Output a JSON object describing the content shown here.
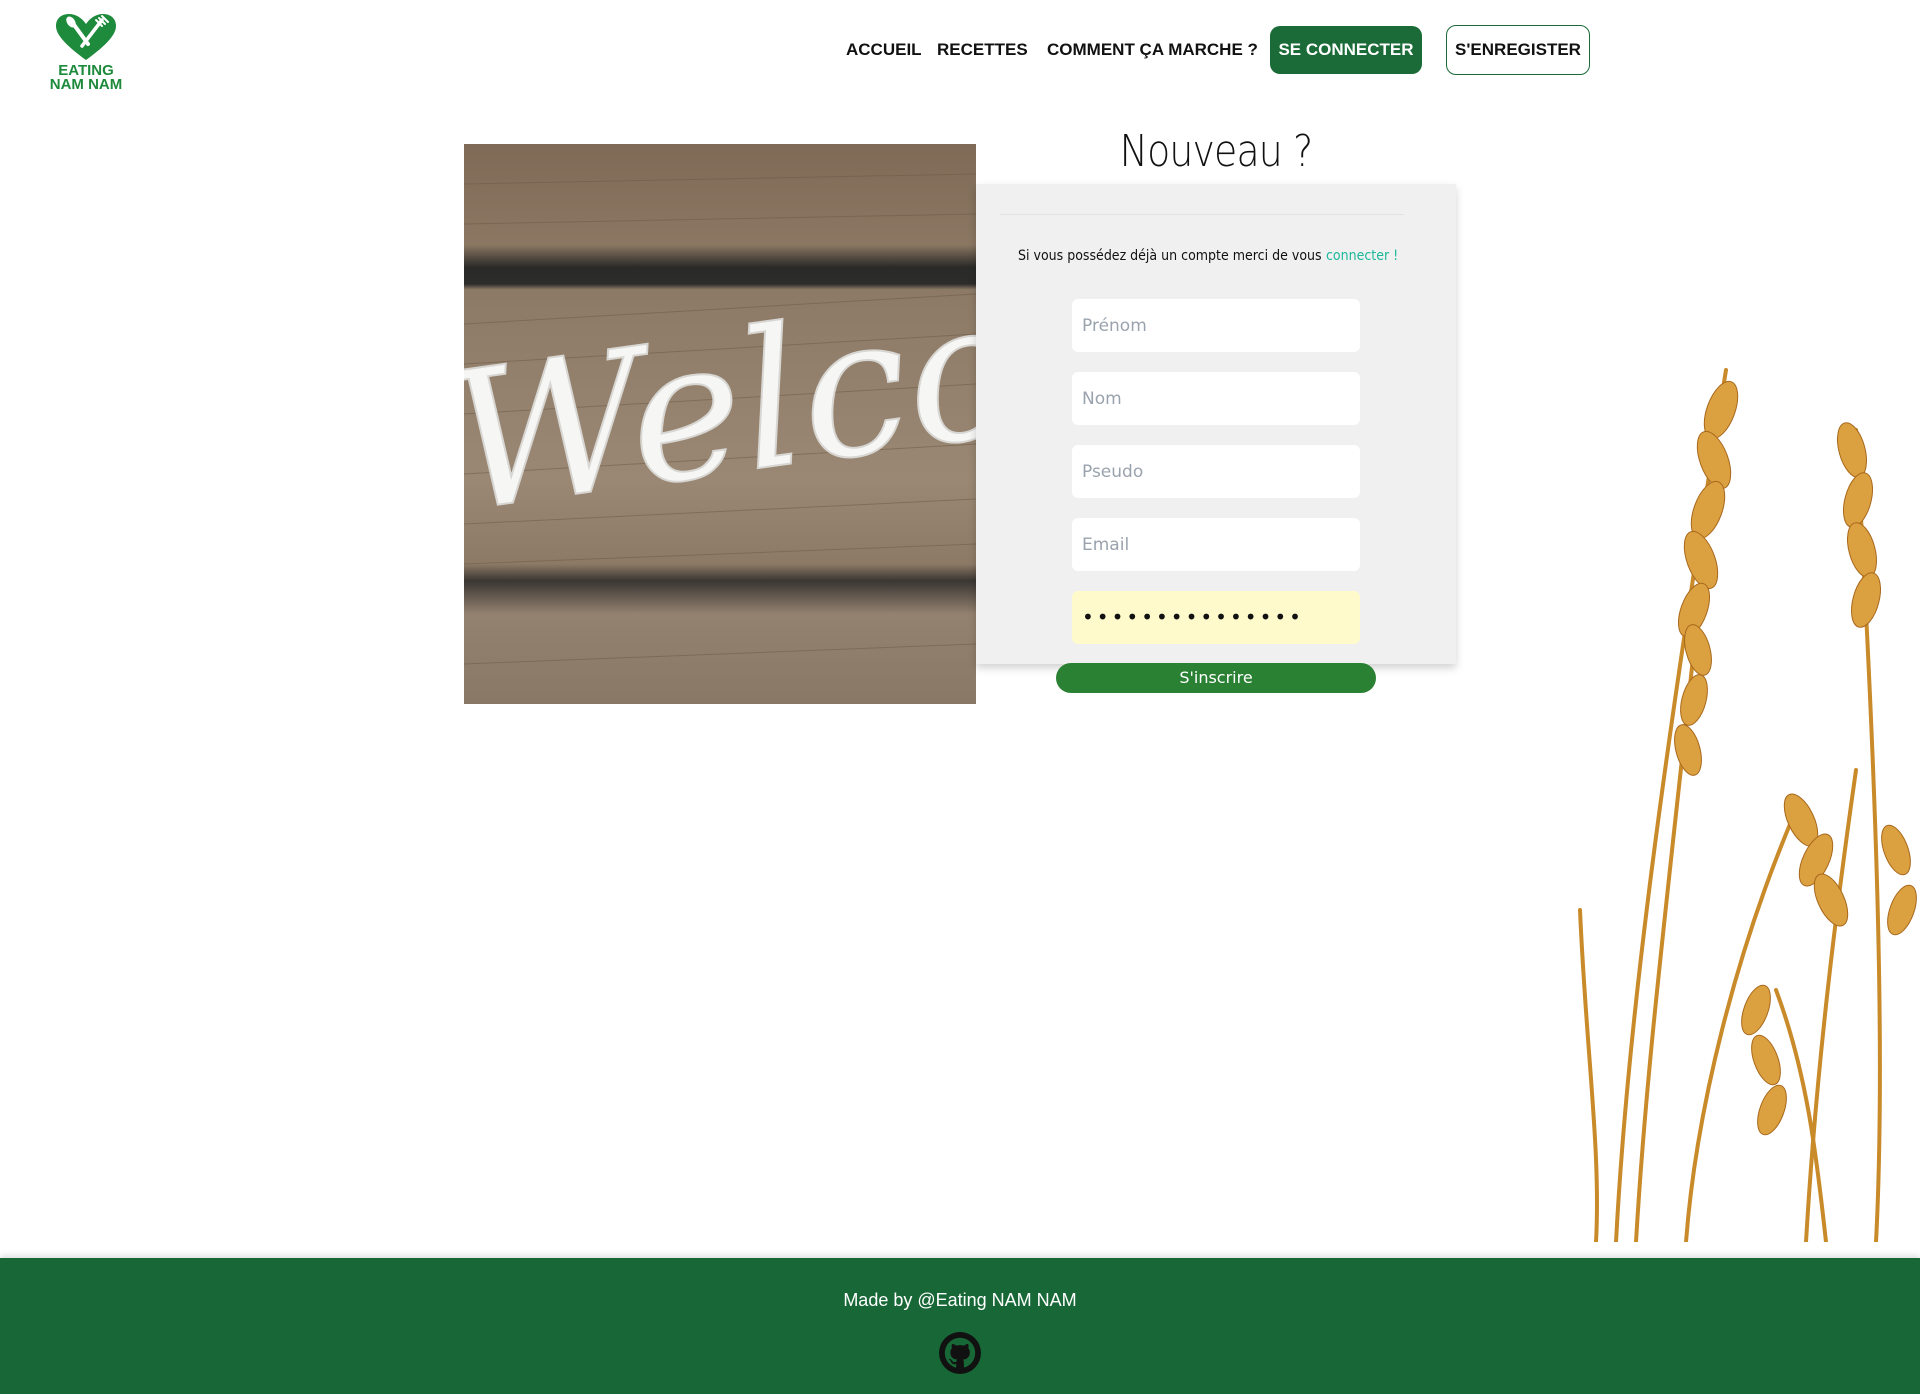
{
  "brand": {
    "line1": "EATING",
    "line2": "NAM NAM",
    "color": "#1e8a3c"
  },
  "nav": {
    "items": [
      {
        "label": "ACCUEIL"
      },
      {
        "label": "RECETTES"
      },
      {
        "label": "COMMENT ÇA MARCHE ?"
      }
    ],
    "login_label": "SE CONNECTER",
    "register_label": "S'ENREGISTER",
    "accent": "#1a6b38"
  },
  "hero_image": {
    "icon": "welcome-sign-image",
    "text": "Welcom"
  },
  "form": {
    "title": "Nouveau ?",
    "already_text": "Si vous possédez déjà un compte merci de vous",
    "login_link": "connecter !",
    "fields": {
      "first_name": {
        "placeholder": "Prénom",
        "value": ""
      },
      "last_name": {
        "placeholder": "Nom",
        "value": ""
      },
      "pseudo": {
        "placeholder": "Pseudo",
        "value": ""
      },
      "email": {
        "placeholder": "Email",
        "value": ""
      },
      "password": {
        "value": "•••••••••••••••"
      }
    },
    "submit_label": "S'inscrire",
    "submit_color": "#2a8033"
  },
  "footer": {
    "made_by": "Made by @Eating NAM NAM",
    "icon": "github-icon",
    "background": "#186837"
  }
}
